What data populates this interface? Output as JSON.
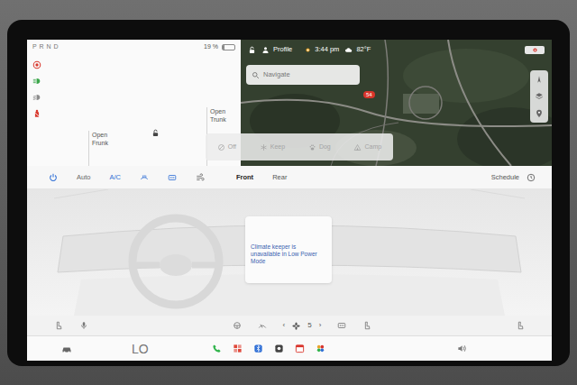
{
  "car": {
    "gear": "P R N D",
    "battery": {
      "reading": "19 %",
      "level": 0.19
    },
    "indicators": [
      {
        "kind": "park",
        "color": "#d93a2f"
      },
      {
        "kind": "lights",
        "color": "#3aa64a"
      },
      {
        "kind": "beam",
        "color": "#8c8c8c"
      },
      {
        "kind": "seatbelt",
        "color": "#d93a2f"
      }
    ],
    "frunk": "Open Frunk",
    "trunk": "Open Trunk"
  },
  "status_bar": {
    "profile": "Profile",
    "time": "3:44 pm",
    "temperature": "82°F"
  },
  "map": {
    "search": {
      "placeholder": "Navigate"
    },
    "pin": "54"
  },
  "climate_keeper": {
    "modes": [
      "Off",
      "Keep",
      "Dog",
      "Camp"
    ]
  },
  "climate": {
    "controls": [
      {
        "kind": "power",
        "on": true
      },
      {
        "kind": "text",
        "label": "Auto",
        "on": false
      },
      {
        "kind": "text",
        "label": "A/C",
        "on": true
      },
      {
        "kind": "defrost-front",
        "on": true
      },
      {
        "kind": "defrost-rear",
        "on": true
      },
      {
        "kind": "airflow",
        "on": false
      }
    ],
    "zones": [
      {
        "label": "Front",
        "selected": true
      },
      {
        "label": "Rear",
        "selected": false
      }
    ],
    "schedule": "Schedule",
    "message": "Climate keeper is unavailable in Low Power Mode"
  },
  "climate_controls": {
    "prev": "‹",
    "fan_speed": "5",
    "next": "›"
  },
  "taskbar": {
    "temperature": "LO",
    "apps": [
      {
        "kind": "phone",
        "color": "#2fb34a"
      },
      {
        "kind": "grid",
        "color": "#e0483a"
      },
      {
        "kind": "bluetooth",
        "color": "#2f6fd6"
      },
      {
        "kind": "camera",
        "color": "#444444"
      },
      {
        "kind": "calendar",
        "color": "#d9342b"
      },
      {
        "kind": "toybox",
        "color": "#e8a42c"
      }
    ]
  }
}
